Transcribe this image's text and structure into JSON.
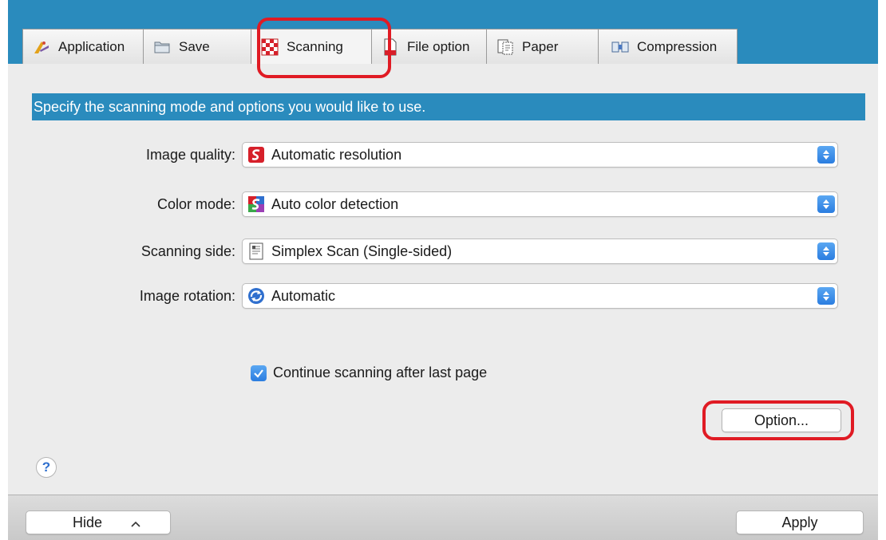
{
  "tabs": [
    {
      "label": "Application",
      "icon": "application-icon"
    },
    {
      "label": "Save",
      "icon": "save-folder-icon"
    },
    {
      "label": "Scanning",
      "icon": "scanning-checker-icon"
    },
    {
      "label": "File option",
      "icon": "file-option-icon"
    },
    {
      "label": "Paper",
      "icon": "paper-icon"
    },
    {
      "label": "Compression",
      "icon": "compression-icon"
    }
  ],
  "active_tab": "Scanning",
  "banner": "Specify the scanning mode and options you would like to use.",
  "settings": {
    "image_quality": {
      "label": "Image quality:",
      "value": "Automatic resolution",
      "icon": "scansnap-red-icon"
    },
    "color_mode": {
      "label": "Color mode:",
      "value": "Auto color detection",
      "icon": "scansnap-color-icon"
    },
    "scanning_side": {
      "label": "Scanning side:",
      "value": "Simplex Scan (Single-sided)",
      "icon": "simplex-page-icon"
    },
    "image_rotation": {
      "label": "Image rotation:",
      "value": "Automatic",
      "icon": "rotation-arrows-icon"
    }
  },
  "continue_scanning": {
    "label": "Continue scanning after last page",
    "checked": true
  },
  "option_button": "Option...",
  "help": "?",
  "bottom": {
    "hide_label": "Hide",
    "apply_label": "Apply"
  },
  "colors": {
    "accent": "#2a8bbd",
    "highlight": "#e01b24",
    "checkbox": "#2b7de0"
  }
}
